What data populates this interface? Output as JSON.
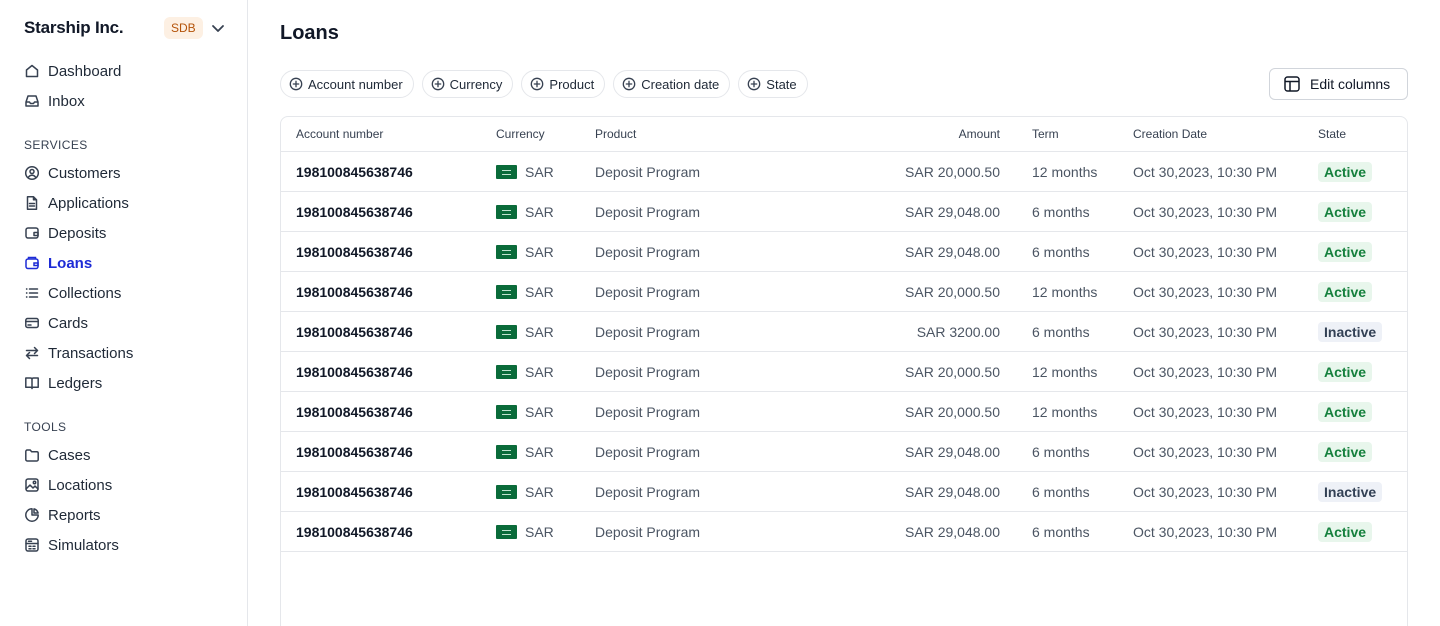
{
  "sidebar": {
    "org_name": "Starship Inc.",
    "org_badge": "SDB",
    "top_items": [
      {
        "label": "Dashboard",
        "icon": "home-icon"
      },
      {
        "label": "Inbox",
        "icon": "inbox-icon"
      }
    ],
    "services_label": "SERVICES",
    "services_items": [
      {
        "label": "Customers",
        "icon": "user-circle-icon"
      },
      {
        "label": "Applications",
        "icon": "document-icon"
      },
      {
        "label": "Deposits",
        "icon": "wallet-icon"
      },
      {
        "label": "Loans",
        "icon": "loans-icon",
        "active": true
      },
      {
        "label": "Collections",
        "icon": "list-icon"
      },
      {
        "label": "Cards",
        "icon": "card-icon"
      },
      {
        "label": "Transactions",
        "icon": "arrows-icon"
      },
      {
        "label": "Ledgers",
        "icon": "book-icon"
      }
    ],
    "tools_label": "TOOLS",
    "tools_items": [
      {
        "label": "Cases",
        "icon": "folder-icon"
      },
      {
        "label": "Locations",
        "icon": "map-icon"
      },
      {
        "label": "Reports",
        "icon": "pie-icon"
      },
      {
        "label": "Simulators",
        "icon": "calculator-icon"
      }
    ]
  },
  "main": {
    "title": "Loans",
    "filters": [
      "Account number",
      "Currency",
      "Product",
      "Creation date",
      "State"
    ],
    "edit_columns_label": "Edit columns",
    "table": {
      "headers": {
        "account": "Account number",
        "currency": "Currency",
        "product": "Product",
        "amount": "Amount",
        "term": "Term",
        "date": "Creation Date",
        "state": "State"
      },
      "rows": [
        {
          "account": "198100845638746",
          "currency": "SAR",
          "product": "Deposit Program",
          "amount": "SAR 20,000.50",
          "term": "12 months",
          "date": "Oct 30,2023, 10:30 PM",
          "state": "Active"
        },
        {
          "account": "198100845638746",
          "currency": "SAR",
          "product": "Deposit Program",
          "amount": "SAR 29,048.00",
          "term": "6 months",
          "date": "Oct 30,2023, 10:30 PM",
          "state": "Active"
        },
        {
          "account": "198100845638746",
          "currency": "SAR",
          "product": "Deposit Program",
          "amount": "SAR 29,048.00",
          "term": "6 months",
          "date": "Oct 30,2023, 10:30 PM",
          "state": "Active"
        },
        {
          "account": "198100845638746",
          "currency": "SAR",
          "product": "Deposit Program",
          "amount": "SAR 20,000.50",
          "term": "12 months",
          "date": "Oct 30,2023, 10:30 PM",
          "state": "Active"
        },
        {
          "account": "198100845638746",
          "currency": "SAR",
          "product": "Deposit Program",
          "amount": "SAR 3200.00",
          "term": "6 months",
          "date": "Oct 30,2023, 10:30 PM",
          "state": "Inactive"
        },
        {
          "account": "198100845638746",
          "currency": "SAR",
          "product": "Deposit Program",
          "amount": "SAR 20,000.50",
          "term": "12 months",
          "date": "Oct 30,2023, 10:30 PM",
          "state": "Active"
        },
        {
          "account": "198100845638746",
          "currency": "SAR",
          "product": "Deposit Program",
          "amount": "SAR 20,000.50",
          "term": "12 months",
          "date": "Oct 30,2023, 10:30 PM",
          "state": "Active"
        },
        {
          "account": "198100845638746",
          "currency": "SAR",
          "product": "Deposit Program",
          "amount": "SAR 29,048.00",
          "term": "6 months",
          "date": "Oct 30,2023, 10:30 PM",
          "state": "Active"
        },
        {
          "account": "198100845638746",
          "currency": "SAR",
          "product": "Deposit Program",
          "amount": "SAR 29,048.00",
          "term": "6 months",
          "date": "Oct 30,2023, 10:30 PM",
          "state": "Inactive"
        },
        {
          "account": "198100845638746",
          "currency": "SAR",
          "product": "Deposit Program",
          "amount": "SAR 29,048.00",
          "term": "6 months",
          "date": "Oct 30,2023, 10:30 PM",
          "state": "Active"
        }
      ]
    }
  },
  "colors": {
    "accent": "#1d2bd6",
    "active_text": "#15803d",
    "active_bg": "#e8f6ec",
    "inactive_text": "#334155",
    "inactive_bg": "#eef1f7",
    "flag_green": "#0a6b3a"
  }
}
